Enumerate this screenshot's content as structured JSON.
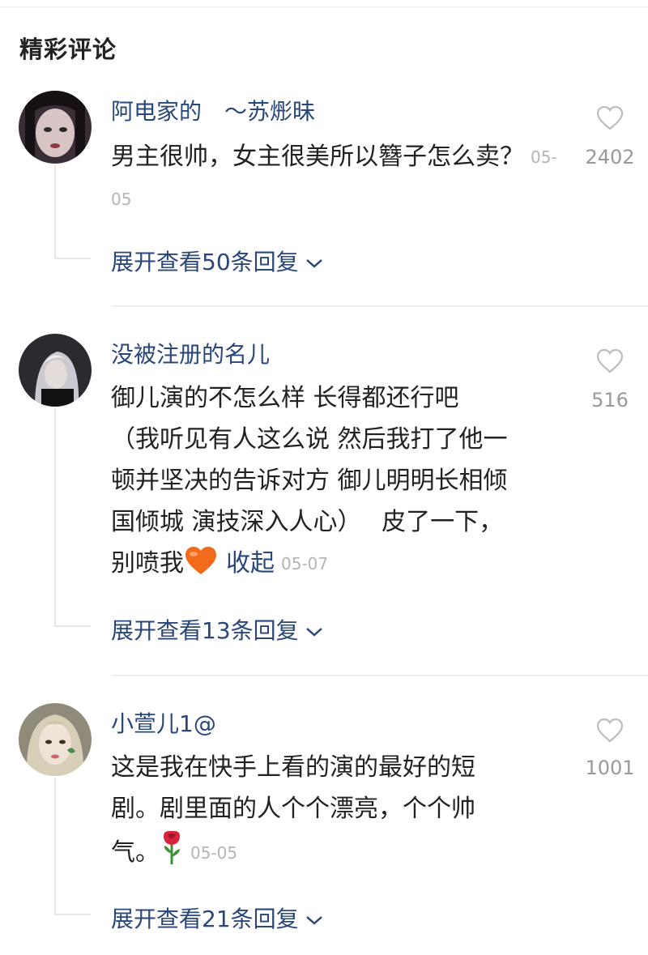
{
  "section_title": "精彩评论",
  "comments": [
    {
      "username": "阿电家的　～苏烿昧",
      "text": "男主很帅，女主很美所以簪子怎么卖？",
      "timestamp": "05-05",
      "likes": "2402",
      "expand_label": "展开查看50条回复"
    },
    {
      "username": "没被注册的名儿",
      "text_parts": [
        "御儿演的不怎么样 长得都还行吧",
        "（我听见有人这么说 然后我打了他一",
        "顿并坚决的告诉对方 御儿明明长相倾",
        "国倾城 演技深入人心）　 皮了一下，",
        "别喷我"
      ],
      "emoji": "orange-heart",
      "collapse_label": "收起",
      "timestamp": "05-07",
      "likes": "516",
      "expand_label": "展开查看13条回复"
    },
    {
      "username": "小萱儿1@",
      "text_parts": [
        "这是我在快手上看的演的最好的短",
        "剧。剧里面的人个个漂亮，个个帅",
        "气。"
      ],
      "emoji": "rose",
      "timestamp": "05-05",
      "likes": "1001",
      "expand_label": "展开查看21条回复"
    }
  ],
  "colors": {
    "username": "#29477a",
    "link": "#29477a",
    "body_text": "#222222",
    "timestamp": "#b5b5b5",
    "like_count": "#9a9a9a",
    "divider": "#efefef"
  }
}
